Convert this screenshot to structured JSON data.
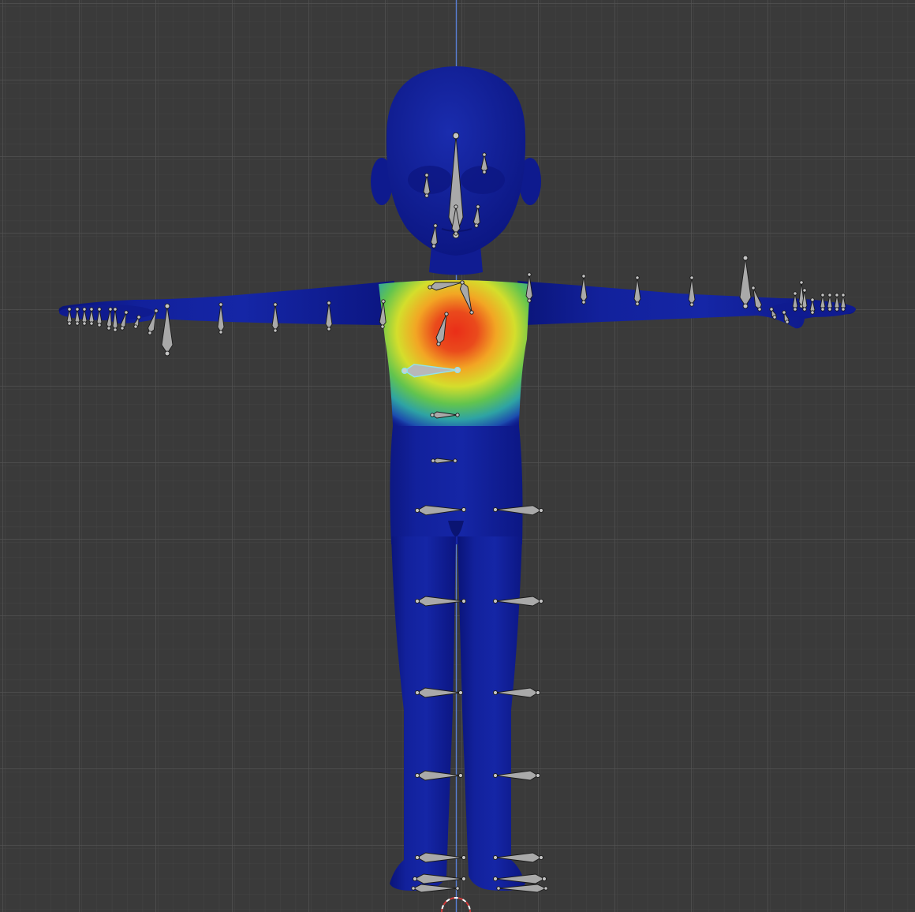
{
  "viewport": {
    "mode": "weight-paint",
    "view": "front-orthographic",
    "background_color": "#3a3a3a",
    "grid_minor_color": "#444444",
    "grid_major_color": "#505050",
    "z_axis_color": "#5a7fd6"
  },
  "mesh": {
    "object": "character-body",
    "base_weight_color": "#0f1a94",
    "weight_gradient": [
      "#0f1a94",
      "#1d4fb0",
      "#2fa5a0",
      "#5fc24a",
      "#d6dc2a",
      "#f0a020",
      "#e83a1c"
    ],
    "active_bone": "chest-bone",
    "peak_weight": 1.0
  },
  "armature": {
    "bone_color": "#a9a9a9",
    "active_bone_outline": "#8fe3f0"
  }
}
